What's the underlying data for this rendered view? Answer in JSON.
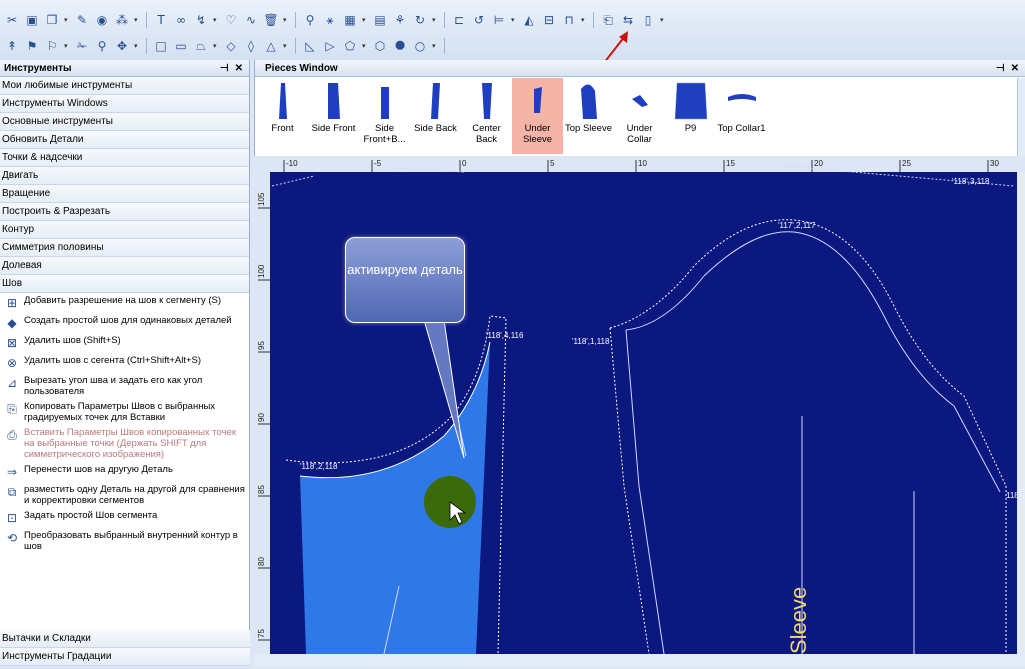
{
  "toolbar": {
    "row1": [
      "cut-icon",
      "page-icon",
      "copy-icon",
      "pen-icon",
      "circle-icon",
      "node-icon",
      "text-icon",
      "loop-icon",
      "bend-icon",
      "heart-icon",
      "wave-icon",
      "trash-icon",
      "needle-icon",
      "split-icon",
      "grid-icon",
      "frame-icon",
      "tree-icon",
      "refresh-icon",
      "snap-icon",
      "rotate-icon",
      "align-icon",
      "mirror-icon",
      "measure-icon",
      "ruler-icon",
      "book-icon",
      "flip-icon",
      "doc-icon"
    ],
    "row2": [
      "pointer-icon",
      "walker-icon",
      "mark-icon",
      "scissors-icon",
      "pin-icon",
      "drag-icon",
      "square-icon",
      "rect-icon",
      "trapezoid-icon",
      "diamond-icon",
      "kite-icon",
      "triangle-icon",
      "right-triangle-icon",
      "flag-icon",
      "pentagon-icon",
      "hexagon-icon",
      "octagon-icon",
      "circle-shape-icon"
    ]
  },
  "left_panel": {
    "title": "Инструменты",
    "categories": [
      "Мои любимые инструменты",
      "Инструменты Windows",
      "Основные инструменты",
      "Обновить Детали",
      "Точки & надсечки",
      "Двигать",
      "Вращение",
      "Построить & Разрезать",
      "Контур",
      "Симметрия половины",
      "Долевая",
      "Шов"
    ],
    "tools": [
      {
        "icon": "seam-add-icon",
        "label": "Добавить разрешение на шов к сегменту (S)",
        "disabled": false
      },
      {
        "icon": "diamond-seam-icon",
        "label": "Создать простой шов для одинаковых деталей",
        "disabled": false
      },
      {
        "icon": "seam-remove-icon",
        "label": "Удалить шов (Shift+S)",
        "disabled": false
      },
      {
        "icon": "seam-segment-remove-icon",
        "label": "Удалить шов с сегента (Ctrl+Shift+Alt+S)",
        "disabled": false
      },
      {
        "icon": "corner-cut-icon",
        "label": "Вырезать угол шва и задать его как угол пользователя",
        "disabled": false
      },
      {
        "icon": "copy-params-icon",
        "label": "Копировать Параметры Швов с выбранных градируемых точек для Вставки",
        "disabled": false
      },
      {
        "icon": "paste-params-icon",
        "label": "Вставить Параметры Швов копированных точек  на выбранные точки (Держать SHIFT для симметрического изображения)",
        "disabled": true
      },
      {
        "icon": "move-seam-icon",
        "label": "Перенести шов на другую Деталь",
        "disabled": false
      },
      {
        "icon": "overlay-icon",
        "label": "разместить одну Деталь на другой для сравнения и корректировки сегментов",
        "disabled": false
      },
      {
        "icon": "simple-seam-icon",
        "label": "Задать простой Шов сегмента",
        "disabled": false
      },
      {
        "icon": "convert-contour-icon",
        "label": "Преобразовать выбранный внутренний контур в шов",
        "disabled": false
      }
    ],
    "bottom_categories": [
      "Вытачки и Складки",
      "Инструменты Градации"
    ]
  },
  "pieces_window": {
    "title": "Pieces Window",
    "pieces": [
      {
        "label": "Front",
        "selected": false
      },
      {
        "label": "Side Front",
        "selected": false
      },
      {
        "label": "Side Front+B...",
        "selected": false
      },
      {
        "label": "Side Back",
        "selected": false
      },
      {
        "label": "Center Back",
        "selected": false
      },
      {
        "label": "Under Sleeve",
        "selected": true
      },
      {
        "label": "Top Sleeve",
        "selected": false
      },
      {
        "label": "Under Collar",
        "selected": false
      },
      {
        "label": "P9",
        "selected": false
      },
      {
        "label": "Top Collar1",
        "selected": false
      }
    ]
  },
  "ruler": {
    "top_ticks": [
      "-10",
      "-5",
      "0",
      "5",
      "10",
      "15",
      "20",
      "25",
      "30"
    ],
    "left_ticks": [
      "105",
      "100",
      "95",
      "90",
      "85",
      "80",
      "75"
    ]
  },
  "canvas": {
    "point_labels": [
      "'118',4,116",
      "'118',2,118",
      "'117',2,117",
      "'118',1,118",
      "'118',3,118",
      "118"
    ],
    "vertical_text": "Sleeve",
    "tooltip": "активируем деталь"
  },
  "colors": {
    "canvas_bg": "#0b1880",
    "selected_piece": "#2f78e8",
    "accent": "#f5b4a8"
  }
}
